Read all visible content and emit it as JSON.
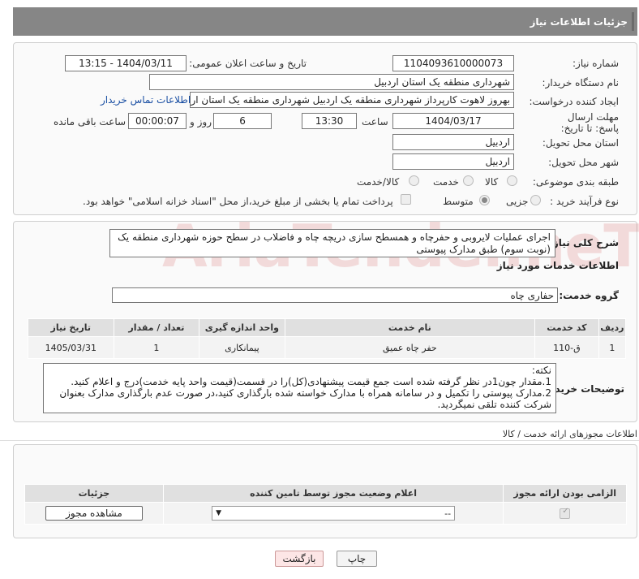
{
  "header": {
    "title": "جزئیات اطلاعات نیاز"
  },
  "need": {
    "number_label": "شماره نیاز:",
    "number_value": "1104093610000073",
    "announce_label": "تاریخ و ساعت اعلان عمومی:",
    "announce_value": "1404/03/11 - 13:15",
    "buyer_label": "نام دستگاه خریدار:",
    "buyer_value": "شهرداری منطقه یک استان اردبیل",
    "creator_label": "ایجاد کننده درخواست:",
    "creator_value": "بهروز لاهوت کارپرداز شهرداری منطقه یک اردبیل شهرداری منطقه یک استان اردب",
    "contact_link": "اطلاعات تماس خریدار",
    "deadline_label": "مهلت ارسال پاسخ: تا تاریخ:",
    "deadline_date": "1404/03/17",
    "time_label": "ساعت",
    "deadline_time": "13:30",
    "days_value": "6",
    "days_label": "روز و",
    "remaining_value": "00:00:07",
    "remaining_label": "ساعت باقی مانده",
    "province_label": "استان محل تحویل:",
    "province_value": "اردبیل",
    "city_label": "شهر محل تحویل:",
    "city_value": "اردبیل",
    "category_label": "طبقه بندی موضوعی:",
    "category_options": [
      "کالا",
      "خدمت",
      "کالا/خدمت"
    ],
    "process_label": "نوع فرآیند خرید :",
    "process_options": [
      "جزیی",
      "متوسط"
    ],
    "payment_note": "پرداخت تمام یا بخشی از مبلغ خرید،از محل \"اسناد خزانه اسلامی\" خواهد بود."
  },
  "description": {
    "label": "شرح کلی نیاز:",
    "text": "اجرای عملیات لایروبی و حفرچاه و همسطح سازی دریچه چاه و فاضلاب در سطح حوزه شهرداری منطقه یک (نوبت سوم) طبق مدارک پیوستی"
  },
  "services": {
    "section_title": "اطلاعات خدمات مورد نیاز",
    "group_label": "گروه خدمت:",
    "group_value": "حفاری چاه",
    "columns": [
      "ردیف",
      "کد خدمت",
      "نام خدمت",
      "واحد اندازه گیری",
      "تعداد / مقدار",
      "تاریخ نیاز"
    ],
    "rows": [
      [
        "1",
        "ق-110",
        "حفر چاه عمیق",
        "پیمانکاری",
        "1",
        "1405/03/31"
      ]
    ]
  },
  "buyer_notes": {
    "label": "توضیحات خریدار:",
    "lines": [
      "نکته:",
      "1.مقدار چون1در نظر گرفته شده است جمع قیمت پیشنهادی(کل)را در قسمت(قیمت واحد پایه خدمت)درج و اعلام کنید.",
      "2.مدارک پیوستی را تکمیل و در سامانه همراه با مدارک خواسته شده بارگذاری کنید،در صورت عدم بارگذاری مدارک بعنوان",
      "شرکت کننده تلقی نمیگردید."
    ]
  },
  "permits": {
    "section_title": "اطلاعات مجوزهای ارائه خدمت / کالا",
    "columns": [
      "الزامی بودن ارائه مجوز",
      "اعلام وضعیت مجوز توسط تامین کننده",
      "جزئیات"
    ],
    "select_value": "--",
    "view_button": "مشاهده مجوز"
  },
  "actions": {
    "print": "چاپ",
    "back": "بازگشت"
  },
  "watermark": {
    "text": "AriaTender.neT"
  }
}
